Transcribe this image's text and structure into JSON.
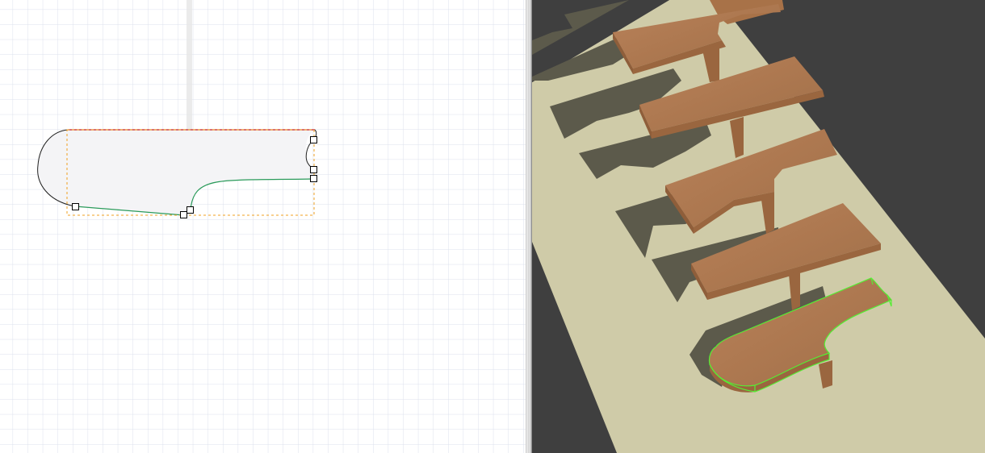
{
  "window": {
    "views": [
      "plan-2d-grid",
      "perspective-3d-view"
    ]
  },
  "plan_view": {
    "grid_color": "#d0d6e4",
    "shape_fill": "#f4f4f6",
    "selected_edge_color": "#cc2222",
    "curve_edge_color": "#2a9a5a",
    "outline_color": "#222222",
    "bbox_color": "#f0a020",
    "handle_count": 6
  },
  "perspective_view": {
    "background_color": "#3f3f3f",
    "stringer_color": "#cfcba8",
    "shadow_color": "#5a584a",
    "tread_color": "#b27a4e",
    "selection_outline_color": "#55ee33",
    "tread_count": 5,
    "selected_tread": 5
  }
}
